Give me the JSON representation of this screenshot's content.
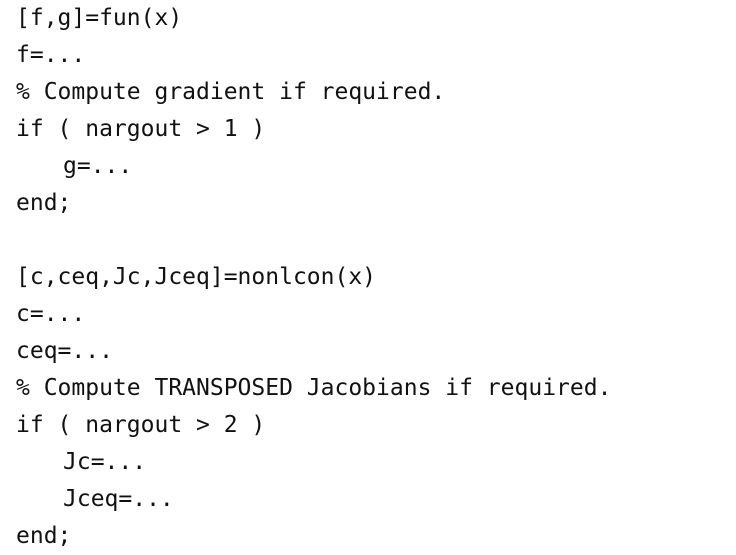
{
  "blocks": [
    {
      "lines": [
        "[f,g]=fun(x)",
        "f=...",
        "% Compute gradient if required.",
        "if ( nargout > 1 )",
        "g=...",
        "end;"
      ]
    },
    {
      "lines": [
        "[c,ceq,Jc,Jceq]=nonlcon(x)",
        "c=...",
        "ceq=...",
        "% Compute TRANSPOSED Jacobians if required.",
        "if ( nargout > 2 )",
        "Jc=...",
        "Jceq=...",
        "end;"
      ]
    }
  ]
}
